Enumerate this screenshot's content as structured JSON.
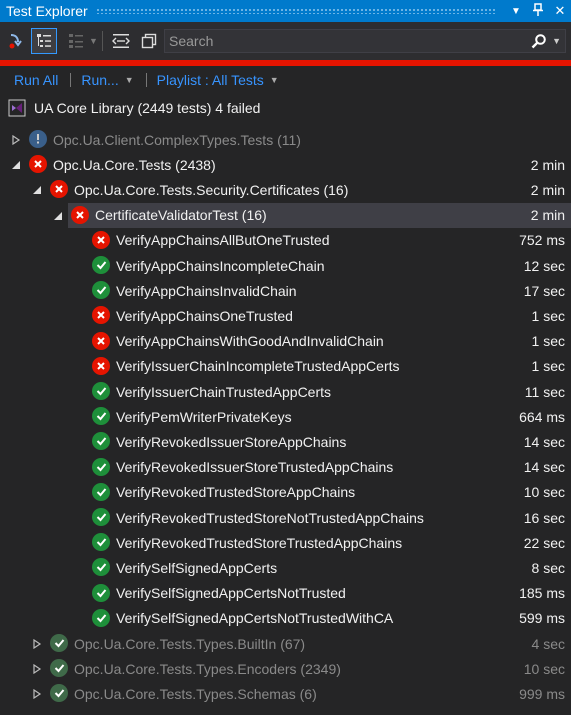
{
  "title_bar": {
    "title": "Test Explorer",
    "dropdown_glyph": "▼",
    "pin_glyph": "⊥",
    "close_glyph": "✕"
  },
  "toolbar": {
    "icons": [
      "run-failed-icon",
      "group-by-icon",
      "hierarchy-icon",
      "expand-collapse-icon",
      "copy-icon"
    ],
    "search_placeholder": "Search"
  },
  "actions": {
    "run_all": "Run All",
    "run_dropdown": "Run...",
    "playlist": "Playlist : All Tests"
  },
  "summary": {
    "label": "UA Core Library (2449 tests) 4 failed"
  },
  "tree": [
    {
      "name": "Opc.Ua.Client.ComplexTypes.Tests (11)",
      "duration": "",
      "status": "info",
      "expander": "collapsed",
      "dim": true
    },
    {
      "name": "Opc.Ua.Core.Tests (2438)",
      "duration": "2 min",
      "status": "fail",
      "expander": "expanded",
      "dim": false
    },
    {
      "name": "Opc.Ua.Core.Tests.Security.Certificates (16)",
      "duration": "2 min",
      "status": "fail",
      "expander": "expanded",
      "dim": false
    },
    {
      "name": "CertificateValidatorTest (16)",
      "duration": "2 min",
      "status": "fail",
      "expander": "expanded",
      "dim": false,
      "selected": true
    },
    {
      "name": "VerifyAppChainsAllButOneTrusted",
      "duration": "752 ms",
      "status": "fail"
    },
    {
      "name": "VerifyAppChainsIncompleteChain",
      "duration": "12 sec",
      "status": "pass"
    },
    {
      "name": "VerifyAppChainsInvalidChain",
      "duration": "17 sec",
      "status": "pass"
    },
    {
      "name": "VerifyAppChainsOneTrusted",
      "duration": "1 sec",
      "status": "fail"
    },
    {
      "name": "VerifyAppChainsWithGoodAndInvalidChain",
      "duration": "1 sec",
      "status": "fail"
    },
    {
      "name": "VerifyIssuerChainIncompleteTrustedAppCerts",
      "duration": "1 sec",
      "status": "fail"
    },
    {
      "name": "VerifyIssuerChainTrustedAppCerts",
      "duration": "11 sec",
      "status": "pass"
    },
    {
      "name": "VerifyPemWriterPrivateKeys",
      "duration": "664 ms",
      "status": "pass"
    },
    {
      "name": "VerifyRevokedIssuerStoreAppChains",
      "duration": "14 sec",
      "status": "pass"
    },
    {
      "name": "VerifyRevokedIssuerStoreTrustedAppChains",
      "duration": "14 sec",
      "status": "pass"
    },
    {
      "name": "VerifyRevokedTrustedStoreAppChains",
      "duration": "10 sec",
      "status": "pass"
    },
    {
      "name": "VerifyRevokedTrustedStoreNotTrustedAppChains",
      "duration": "16 sec",
      "status": "pass"
    },
    {
      "name": "VerifyRevokedTrustedStoreTrustedAppChains",
      "duration": "22 sec",
      "status": "pass"
    },
    {
      "name": "VerifySelfSignedAppCerts",
      "duration": "8 sec",
      "status": "pass"
    },
    {
      "name": "VerifySelfSignedAppCertsNotTrusted",
      "duration": "185 ms",
      "status": "pass"
    },
    {
      "name": "VerifySelfSignedAppCertsNotTrustedWithCA",
      "duration": "599 ms",
      "status": "pass"
    },
    {
      "name": "Opc.Ua.Core.Tests.Types.BuiltIn (67)",
      "duration": "4 sec",
      "status": "pass",
      "expander": "collapsed",
      "dim": true
    },
    {
      "name": "Opc.Ua.Core.Tests.Types.Encoders (2349)",
      "duration": "10 sec",
      "status": "pass",
      "expander": "collapsed",
      "dim": true
    },
    {
      "name": "Opc.Ua.Core.Tests.Types.Schemas (6)",
      "duration": "999 ms",
      "status": "pass",
      "expander": "collapsed",
      "dim": true
    }
  ],
  "colors": {
    "accent": "#007acc",
    "fail": "#e51400",
    "pass": "#1e8f3a",
    "link": "#3794ff",
    "background": "#252526"
  }
}
